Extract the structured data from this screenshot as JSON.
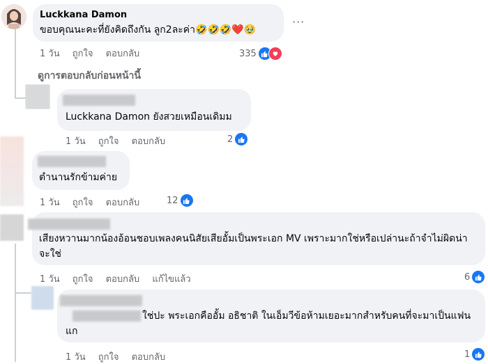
{
  "comment1": {
    "author": "Luckkana Damon",
    "text": "ขอบคุณนะคะที่ยังคิดถึงกัน ลูก2ละค่า🤣🤣🤣❤️🥹",
    "time": "1 วัน",
    "like": "ถูกใจ",
    "reply": "ตอบกลับ",
    "reactions": "335"
  },
  "more_label": "···",
  "view_previous": "ดูการตอบกลับก่อนหน้านี้",
  "reply1": {
    "mention": "Luckkana Damon",
    "text": " ยังสวยเหมือนเดิมม",
    "time": "1 วัน",
    "like": "ถูกใจ",
    "reply": "ตอบกลับ",
    "reactions": "2"
  },
  "comment2": {
    "text": "ตำนานรักข้ามค่าย",
    "time": "1 วัน",
    "like": "ถูกใจ",
    "reply": "ตอบกลับ",
    "reactions": "12"
  },
  "comment3": {
    "text": "เสียงหวานมากน้องอ้อนชอบเพลงคนนิสัยเสียอั้มเป็นพระเอก MV เพราะมากใช่หรือเปล่านะถ้าจำไม่ผิดน่าจะใช่",
    "time": "1 วัน",
    "like": "ถูกใจ",
    "reply": "ตอบกลับ",
    "edited": "แก้ไขแล้ว",
    "reactions": "6"
  },
  "reply2": {
    "text": "ใช่ปะ พระเอกคืออั้ม อธิชาติ ในเอ็มวีข้อห้ามเยอะมากสำหรับคนที่จะมาเป็นแฟนแก",
    "time": "1 วัน",
    "like": "ถูกใจ",
    "reply": "ตอบกลับ",
    "reactions": "1"
  },
  "icons": {
    "like": "like-reaction-icon",
    "love": "love-reaction-icon",
    "more": "more-options-icon"
  },
  "colors": {
    "bubble": "#f0f2f5",
    "like_blue": "#1877f2",
    "love_red": "#f33e58",
    "meta_gray": "#65676b"
  }
}
